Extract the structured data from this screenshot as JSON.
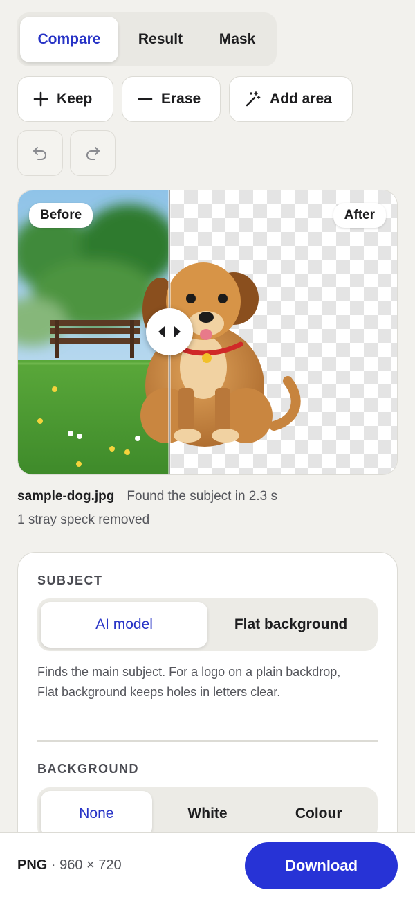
{
  "view_tabs": [
    {
      "label": "Compare",
      "active": true
    },
    {
      "label": "Result",
      "active": false
    },
    {
      "label": "Mask",
      "active": false
    }
  ],
  "tools": {
    "keep": "Keep",
    "erase": "Erase",
    "add_area": "Add area"
  },
  "history": {
    "undo_icon": "undo-icon",
    "redo_icon": "redo-icon"
  },
  "preview": {
    "before_label": "Before",
    "after_label": "After"
  },
  "file": {
    "name": "sample-dog.jpg",
    "status": "Found the subject in 2.3 s",
    "note": "1 stray speck removed"
  },
  "settings": {
    "subject": {
      "title": "SUBJECT",
      "options": [
        {
          "label": "AI model",
          "active": true
        },
        {
          "label": "Flat background",
          "active": false
        }
      ],
      "help": "Finds the main subject. For a logo on a plain backdrop, Flat background keeps holes in letters clear."
    },
    "background": {
      "title": "BACKGROUND",
      "options": [
        {
          "label": "None",
          "active": true
        },
        {
          "label": "White",
          "active": false
        },
        {
          "label": "Colour",
          "active": false
        }
      ]
    }
  },
  "footer": {
    "format": "PNG",
    "dimensions": "960 × 720",
    "download_label": "Download"
  },
  "colors": {
    "accent": "#2733d6",
    "background": "#f2f1ed"
  }
}
